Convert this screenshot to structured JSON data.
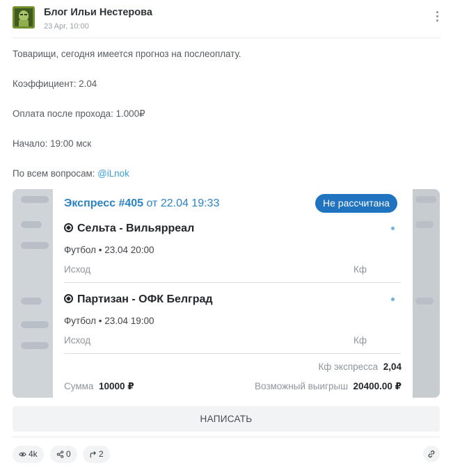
{
  "post": {
    "author": "Блог Ильи Нестерова",
    "date": "23 Apr, 10:00",
    "lines": [
      "Товарищи, сегодня имеется прогноз на послеоплату.",
      "Коэффициент: 2.04",
      "Оплата после прохода: 1.000₽",
      "Начало: 19:00 мск"
    ],
    "contact_prefix": "По всем вопросам: ",
    "contact_link": "@iLnok"
  },
  "bet_card": {
    "title_word": "Экспресс",
    "number": "#405",
    "from_text": "от 22.04 19:33",
    "status": "Не рассчитана",
    "matches": [
      {
        "name": "Сельта - Вильярреал",
        "meta": "Футбол • 23.04 20:00",
        "outcome_label": "Исход",
        "coef_label": "Кф"
      },
      {
        "name": "Партизан - ОФК Белград",
        "meta": "Футбол • 23.04 19:00",
        "outcome_label": "Исход",
        "coef_label": "Кф"
      }
    ],
    "express_coef_label": "Кф экспресса",
    "express_coef_value": "2,04",
    "sum_label": "Сумма",
    "sum_value": "10000 ₽",
    "win_label": "Возможный выигрыш",
    "win_value": "20400.00 ₽"
  },
  "actions": {
    "write_button": "НАПИСАТЬ",
    "views": "4k",
    "shares": "0",
    "reposts": "2"
  },
  "icons": [
    "avatar",
    "more-vertical-icon",
    "football-icon",
    "eye-icon",
    "share-icon",
    "repost-icon",
    "link-icon"
  ],
  "colors": {
    "accent": "#2b82c4",
    "badge": "#1f73bf",
    "link": "#3a9ed6"
  }
}
